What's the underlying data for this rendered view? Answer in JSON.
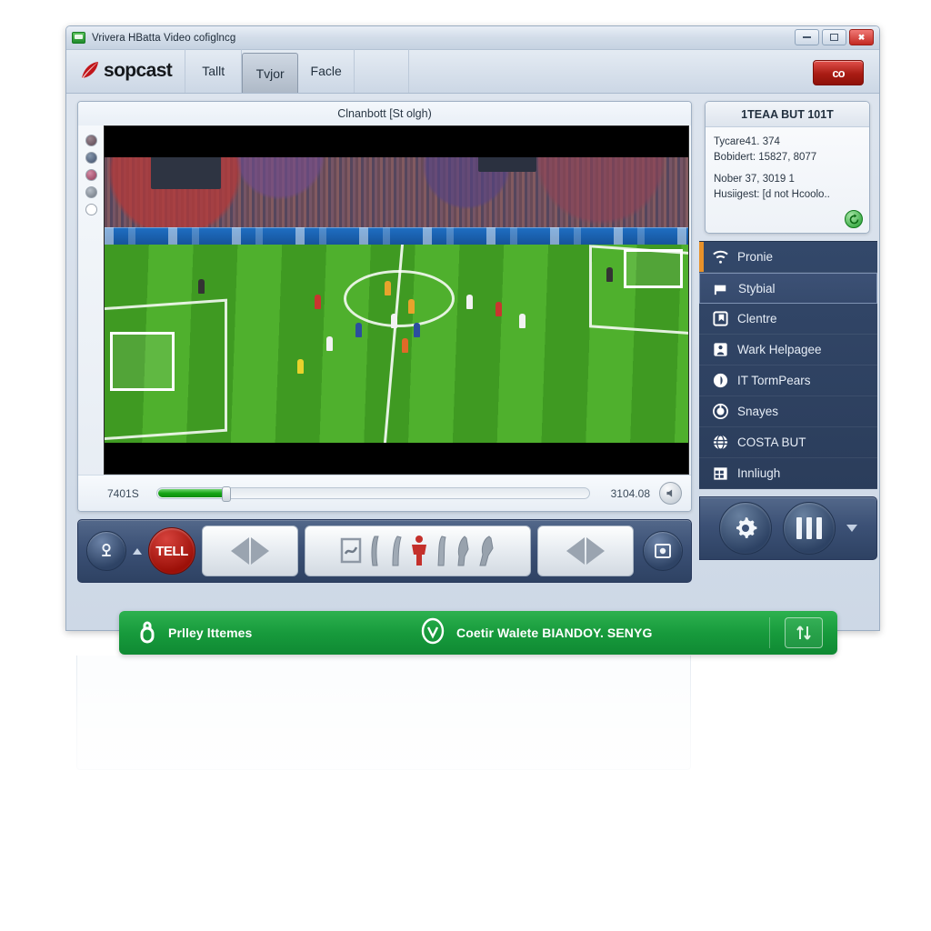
{
  "window": {
    "title": "Vrivera HBatta Video cofiglncg",
    "app_icon": "monitor-icon",
    "controls": {
      "minimize": "minimize-icon",
      "maximize": "maximize-icon",
      "close": "close-icon"
    }
  },
  "brand": {
    "logo_icon": "sopcast-leaf-logo",
    "name": "sopcast"
  },
  "tabs": [
    {
      "label": "Tallt",
      "active": false
    },
    {
      "label": "Tvjor",
      "active": true
    },
    {
      "label": "Facle",
      "active": false
    }
  ],
  "header_button": {
    "label": "co",
    "color": "#a91c14"
  },
  "player": {
    "caption": "Clnanbott [St olgh)",
    "rail_dots": [
      {
        "name": "rail-dot-1",
        "color": "#6b5560"
      },
      {
        "name": "rail-dot-2",
        "color": "#4a5a72"
      },
      {
        "name": "rail-dot-3",
        "color": "#9b4b66"
      },
      {
        "name": "rail-dot-4",
        "color": "#7e8691"
      },
      {
        "name": "rail-dot-5",
        "color": "#ffffff"
      }
    ],
    "seek": {
      "elapsed": "7401S",
      "remaining": "3104.08",
      "progress_percent": 16,
      "volume_icon": "speaker-icon"
    },
    "video_scene": "football-stadium-broadcast"
  },
  "transport": {
    "buttons": [
      {
        "name": "profile-button",
        "icon": "person-badge-icon"
      },
      {
        "name": "expand-caret",
        "icon": "caret-up-icon"
      },
      {
        "name": "tell-button",
        "label": "TELL"
      },
      {
        "name": "nav-left-button",
        "icon": "left-right-diamond-icon"
      },
      {
        "name": "people-panel",
        "icon": "people-row-icon"
      },
      {
        "name": "nav-right-button",
        "icon": "left-right-diamond-icon"
      },
      {
        "name": "record-button",
        "icon": "screen-record-icon"
      }
    ],
    "people_icons": [
      "screen-icon",
      "person-1",
      "person-2",
      "person-highlight",
      "person-4",
      "person-5",
      "person-6"
    ],
    "highlight_color": "#c4302b"
  },
  "info_card": {
    "title": "1TEAA BUT 101T",
    "lines": [
      "Tycare41. 374",
      "Bobidert: 15827, 8077"
    ],
    "lines2": [
      "Nober 37, 3019 1",
      "Husiigest: [d not Hcoolo.."
    ],
    "refresh_icon": "refresh-icon"
  },
  "nav_list": [
    {
      "label": "Pronie",
      "icon": "wifi-question-icon",
      "selected": false,
      "accent": true
    },
    {
      "label": "Stybial",
      "icon": "flag-icon",
      "selected": true,
      "accent": false
    },
    {
      "label": "Clentre",
      "icon": "bookmark-square-icon",
      "selected": false,
      "accent": false
    },
    {
      "label": "Wark Helpagee",
      "icon": "person-square-icon",
      "selected": false,
      "accent": false
    },
    {
      "label": "IT TormPears",
      "icon": "info-circle-icon",
      "selected": false,
      "accent": false
    },
    {
      "label": "Snayes",
      "icon": "target-circle-icon",
      "selected": false,
      "accent": false
    },
    {
      "label": "COSTA BUT",
      "icon": "globe-icon",
      "selected": false,
      "accent": false
    },
    {
      "label": "Innliugh",
      "icon": "calendar-grid-icon",
      "selected": false,
      "accent": false
    }
  ],
  "right_transport": {
    "settings_icon": "gear-icon",
    "pause_icon": "pause-icon",
    "more_icon": "caret-down-icon"
  },
  "banner": {
    "left_icon": "padlock-icon",
    "left_text": "Prlley lttemes",
    "center_icon": "check-circle-icon",
    "center_text": "Coetir Walete BIANDOY. SENYG",
    "right_icon": "sort-arrows-icon",
    "background_color": "#179a3c"
  },
  "colors": {
    "accent_orange": "#e8912a",
    "sidebar_navy": "#2d4060",
    "banner_green": "#179a3c",
    "close_red": "#c32a22",
    "pitch_green": "#4fae2c"
  }
}
